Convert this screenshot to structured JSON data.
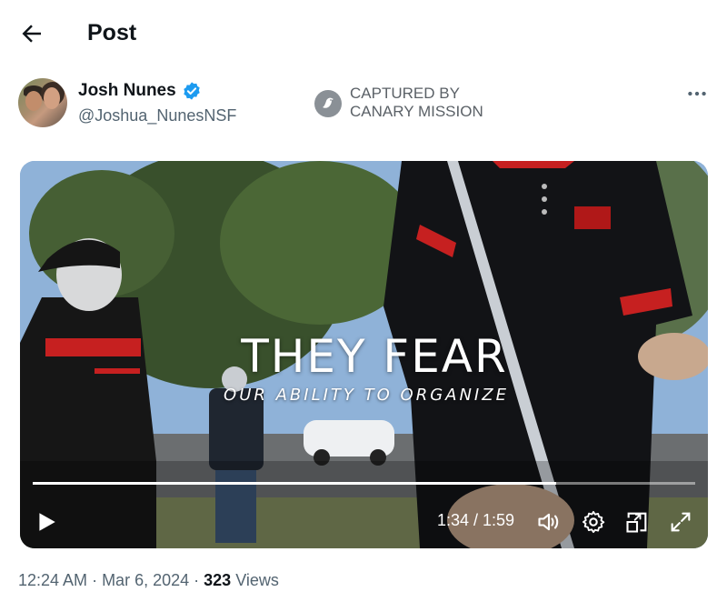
{
  "header": {
    "title": "Post",
    "back_icon": "arrow-left-icon"
  },
  "author": {
    "display_name": "Josh Nunes",
    "handle": "@Joshua_NunesNSF",
    "verified": true,
    "verified_color": "#1d9bf0"
  },
  "watermark": {
    "line1": "CAPTURED BY",
    "line2": "CANARY MISSION",
    "logo_icon": "canary-bird-logo-icon"
  },
  "more_icon": "more-horizontal-icon",
  "video": {
    "overlay_title": "THEY FEAR",
    "overlay_subtitle": "OUR ABILITY TO ORGANIZE",
    "progress": 0.79,
    "time_display": "1:34 / 1:59",
    "controls": [
      "play-icon",
      "volume-icon",
      "settings-icon",
      "picture-in-picture-icon",
      "fullscreen-icon"
    ]
  },
  "meta": {
    "time": "12:24 AM",
    "separator": " · ",
    "date": "Mar 6, 2024",
    "views_count": "323",
    "views_label": "Views"
  },
  "colors": {
    "text": "#0f1419",
    "muted": "#536471",
    "accent": "#1d9bf0"
  }
}
